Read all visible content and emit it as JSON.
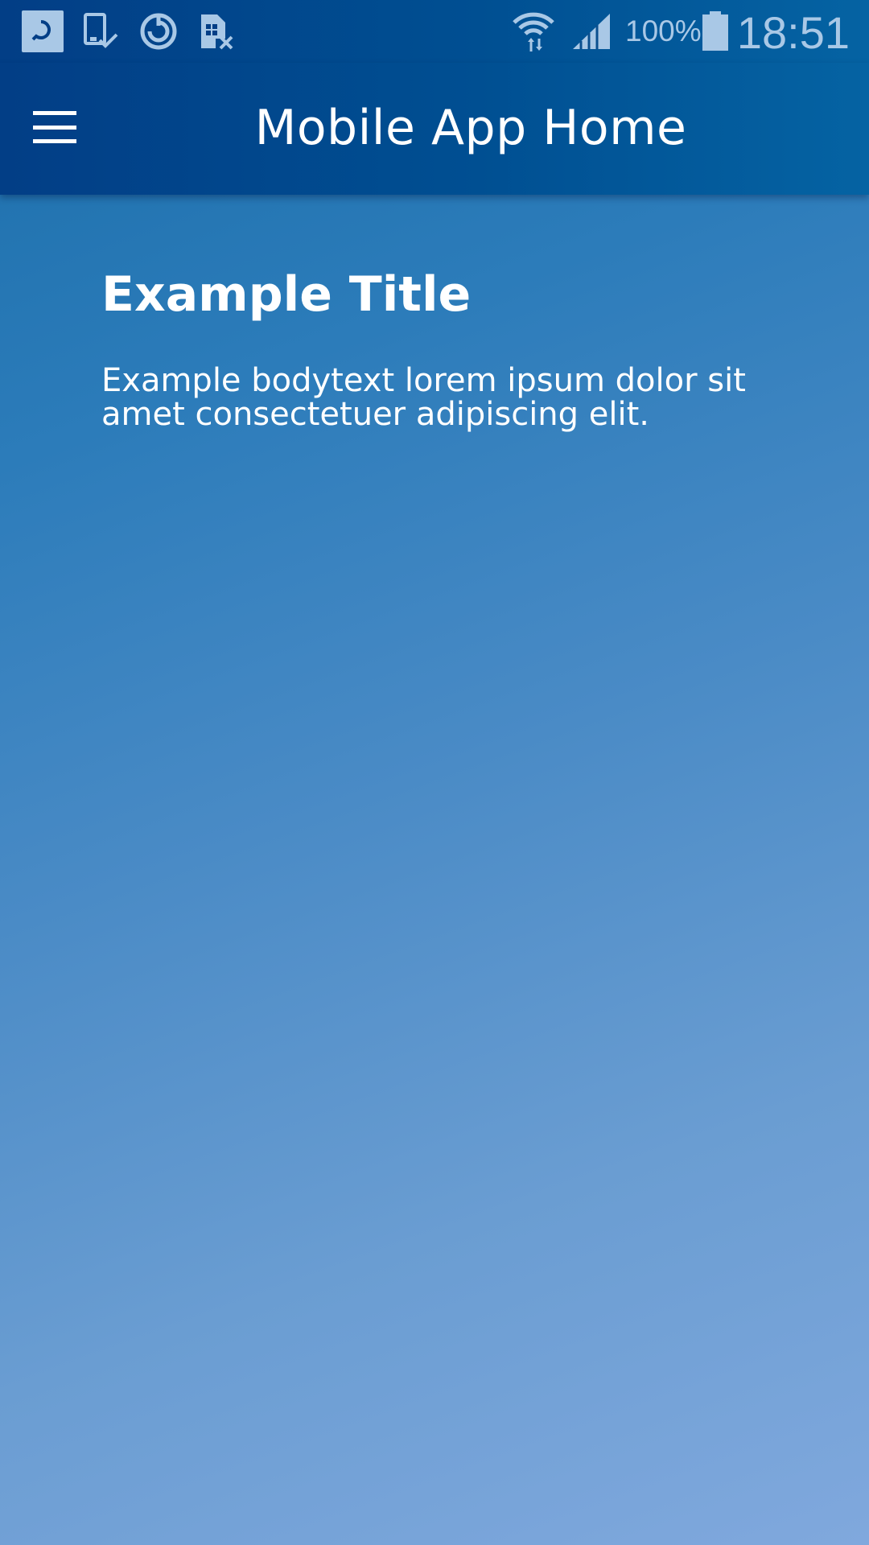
{
  "status_bar": {
    "left_icons": [
      "app-notification-icon",
      "device-check-icon",
      "sync-icon",
      "sim-error-icon"
    ],
    "right_icons": [
      "wifi-icon",
      "signal-icon",
      "battery-icon"
    ],
    "battery_percent": "100%",
    "time": "18:51"
  },
  "app_bar": {
    "menu_icon": "hamburger-menu-icon",
    "title": "Mobile App Home"
  },
  "content": {
    "title": "Example Title",
    "body": "Example bodytext lorem ipsum dolor sit amet consectetuer adipiscing elit."
  },
  "colors": {
    "app_bar": "#004f92",
    "background_top": "#1b6eaa",
    "background_bottom": "#80a8dd",
    "status_icons": "#a9c8e6",
    "text": "#ffffff"
  }
}
